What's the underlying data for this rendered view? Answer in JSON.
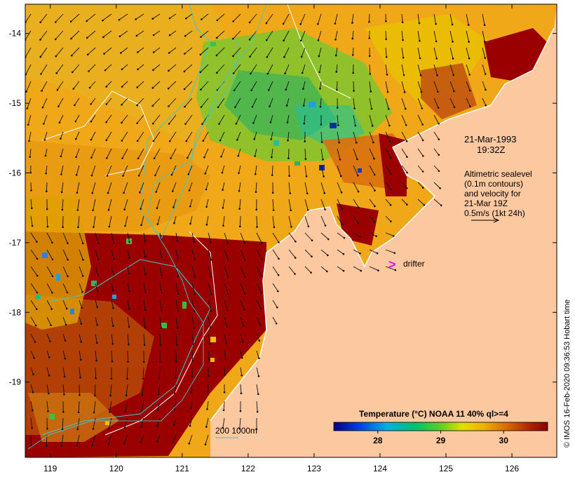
{
  "annotations": {
    "date": "21-Mar-1993",
    "time": "19:32Z",
    "altimetry_lines": [
      "Altimetric sealevel",
      "(0.1m contours)",
      "and velocity for",
      "21-Mar 19Z",
      "0.5m/s (1kt 24h)"
    ],
    "drifter_symbol": ">",
    "drifter_label": "drifter",
    "depth_legend": "200  1000m"
  },
  "colorbar": {
    "title": "Temperature (°C) NOAA 11 40% ql>=4",
    "ticks": [
      "28",
      "29",
      "30"
    ],
    "tick_values": [
      28,
      29,
      30
    ],
    "range": [
      27.3,
      30.7
    ]
  },
  "credit": "© IMOS 16-Feb-2020 09:36:53 Hobart time",
  "axes": {
    "x_ticks": [
      "119",
      "120",
      "121",
      "122",
      "123",
      "124",
      "125",
      "126"
    ],
    "x_values": [
      119,
      120,
      121,
      122,
      123,
      124,
      125,
      126
    ],
    "y_ticks": [
      "-14",
      "-15",
      "-16",
      "-17",
      "-18",
      "-19"
    ],
    "y_values": [
      -14,
      -15,
      -16,
      -17,
      -18,
      -19
    ],
    "lon_range": [
      118.62,
      126.68
    ],
    "lat_range": [
      -13.58,
      -20.08
    ]
  },
  "colors": {
    "land": "#fcc8a0",
    "warm": "#9a0000",
    "drifter": "#ff00ff",
    "shelf_contour_200": "#40c8c8",
    "shelf_contour_1000": "#b0e8e0",
    "sealevel_contour": "#ffffff"
  }
}
